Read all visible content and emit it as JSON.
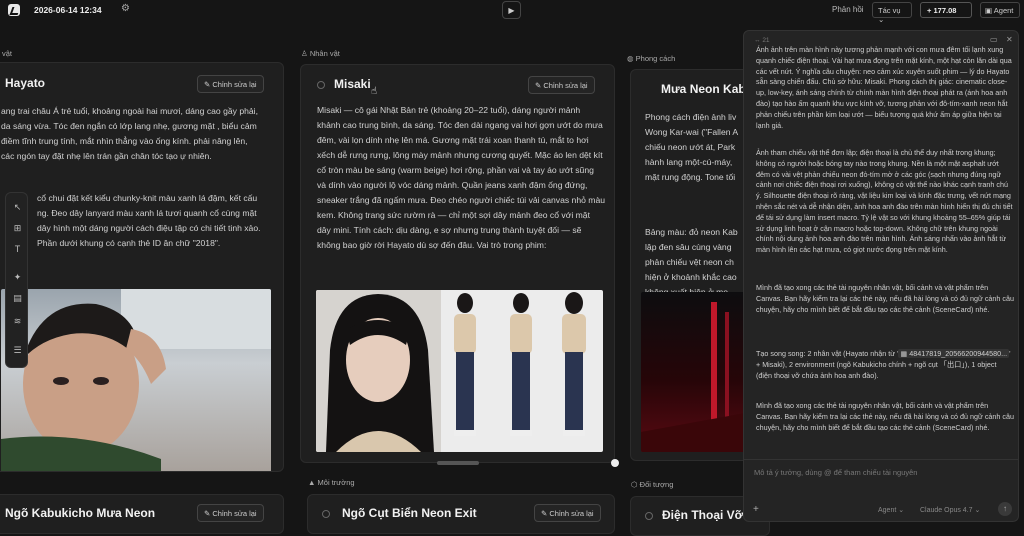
{
  "topbar": {
    "datetime": "2026-06-14 12:34",
    "feedback": "Phản hồi",
    "task_menu": "Tác vụ",
    "credits": "177.08",
    "agent": "Agent"
  },
  "sections": {
    "characters": "Nhân vật",
    "style": "Phong cách",
    "environment": "Môi trường",
    "object": "Đối tượng",
    "left_partial": "vật"
  },
  "edit_label": "Chỉnh sửa lại",
  "cards": {
    "hayato": {
      "title": "Hayato",
      "text": "ang trai châu Á trẻ tuổi, khoảng ngoài hai mươi, dáng cao gầy phải, da sáng vừa. Tóc đen ngắn có lớp lang nhẹ, gương mặt , biểu cảm điềm tĩnh trung tính, mắt nhìn thẳng vào ống kính. phải nâng lên, các ngón tay đặt nhẹ lên trán gần chân tóc tạo ự nhiên.",
      "text2": "cổ chui đặt kết kiểu chunky-knit màu xanh lá đậm, kết cấu ng. Đeo dây lanyard màu xanh lá tươi quanh cổ cùng mặt dây hình một dáng người cách điệu tập có chi tiết tinh xảo. Phần dưới khung có cạnh thẻ ID ân chữ \"2018\"."
    },
    "misaki": {
      "title": "Misaki",
      "text": "Misaki — cô gái Nhật Bản trẻ (khoảng 20–22 tuổi), dáng người mảnh khảnh cao trung bình, da sáng. Tóc đen dài ngang vai hơi gợn ướt do mưa đêm, vài lọn dính nhẹ lên má. Gương mặt trái xoan thanh tú, mắt to hơi xếch dễ rưng rưng, lông mày mảnh nhưng cương quyết. Mặc áo len dệt kít cổ tròn màu be sáng (warm beige) hơi rộng, phần vai và tay áo ướt sũng và dính vào người lộ vóc dáng mảnh. Quần jeans xanh đậm ống đứng, sneaker trắng đã ngấm mưa. Đeo chéo người chiếc túi vải canvas nhỏ màu kem. Không trang sức rườm rà — chỉ một sợi dây mảnh đeo cổ với mặt dây mini. Tính cách: dịu dàng, e sợ nhưng trung thành tuyệt đối — sẽ không bao giờ rời Hayato dù sợ đến đâu. Vai trò trong phim:"
    },
    "neon_style": {
      "title": "Mưa Neon Kab",
      "text": "Phong cách điện ảnh liv Wong Kar-wai (\"Fallen A chiếu neon ướt át, Park hành lang một-cú-máy, mặt rung động. Tone tối",
      "text2": "Bảng màu: đỏ neon Kab lập đen sâu cùng vàng phản chiếu vệt neon ch hiện ở khoảnh khắc cao không xuất hiện ở mọ"
    },
    "env_kabukicho": {
      "title": "Ngõ Kabukicho Mưa Neon"
    },
    "env_exit": {
      "title": "Ngõ Cụt Biển Neon Exit"
    },
    "obj_phone": {
      "title": "Điện Thoại Vỡ"
    }
  },
  "chat": {
    "header_count": "21",
    "para1": "Ánh ảnh trên màn hình này tương phản mạnh với con mưa đêm tối lạnh xung quanh chiếc điện thoại. Vài hạt mưa đọng trên mặt kính, một hạt còn lăn dài qua các vết nứt. Ý nghĩa câu chuyện: neo cảm xúc xuyên suốt phim — lý do Hayato sẵn sàng chiến đấu. Chủ sở hữu: Misaki. Phong cách thị giác: cinematic close-up, low-key, ánh sáng chính từ chính màn hình điện thoại phát ra (ánh hoa anh đào) tạo hào ấm quanh khu vực kính vỡ, tương phản với đô-tím-xanh neon hắt phản chiếu trên phần kim loại ướt — biểu tượng quá khứ ấm áp giữa hiện tại lạnh giá.",
    "para2": "Ảnh tham chiếu vật thể đơn lập; điện thoại là chủ thể duy nhất trong khung; không có người hoặc bóng tay nào trong khung. Nền là một mặt asphalt ướt đêm có vài vệt phản chiếu neon đỏ-tím mờ ở các góc (sạch nhưng đúng ngữ cảnh nơi chiếc điện thoại rơi xuống), không có vật thể nào khác cạnh tranh chú ý. Silhouette điện thoại rõ ràng, vật liệu kim loại và kính đặc trưng, vết nứt mạng nhện sắc nét và dễ nhận diện, ảnh hoa anh đào trên màn hình hiển thị đủ chi tiết để tái sử dụng làm insert macro. Tỷ lệ vật so với khung khoảng 55–65% giúp tái sử dụng linh hoạt ở cận macro hoặc top-down. Không chữ trên khung ngoài chính nội dung ảnh hoa anh đào trên màn hình. Ánh sáng nhấn vào ảnh hắt từ màn hình lên các hạt mưa, có giọt nước đọng trên mặt kính.",
    "para3": "Mình đã tạo xong các thẻ tài nguyên nhân vật, bối cảnh và vật phẩm trên Canvas. Bạn hãy kiểm tra lại các thẻ này, nếu đã hài lòng và có đủ ngữ cảnh câu chuyện, hãy cho mình biết để bắt đầu tạo các thẻ cảnh (SceneCard) nhé.",
    "para4a": "Tạo song song: 2 nhân vật (Hayato nhận từ '",
    "para4b": "48417819_20566200944580...",
    "para4c": "' + Misaki), 2 environment (ngõ Kabukicho chính + ngõ cụt 「出口」), 1 object (điện thoại vỡ chứa ảnh hoa anh đào).",
    "para5": "Mình đã tạo xong các thẻ tài nguyên nhân vật, bối cảnh và vật phẩm trên Canvas. Bạn hãy kiểm tra lại các thẻ này, nếu đã hài lòng và có đủ ngữ cảnh câu chuyện, hãy cho mình biết để bắt đầu tạo các thẻ cảnh (SceneCard) nhé.",
    "input_placeholder": "Mô tả ý tưởng, dùng @ để tham chiếu tài nguyên",
    "agent_mode": "Agent",
    "model": "Claude Opus 4.7"
  },
  "colors": {
    "background": "#151515",
    "card": "#1f1f1f",
    "chat_panel": "#242424",
    "neon_red": "#c0182a"
  },
  "icons": [
    "logo-icon",
    "gear-icon",
    "play-icon",
    "plus-icon",
    "agent-icon",
    "pencil-icon",
    "cursor-icon",
    "send-icon",
    "user-icon",
    "palette-icon",
    "box-icon"
  ]
}
